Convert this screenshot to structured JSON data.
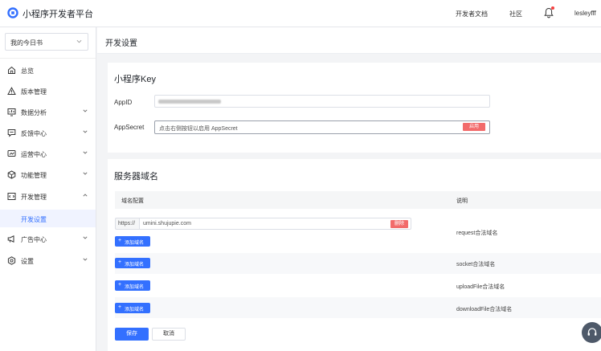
{
  "header": {
    "brand": "小程序开发者平台",
    "links": [
      "开发者文档",
      "社区"
    ],
    "user": "lesleyfff"
  },
  "sidebar": {
    "app_select": "我的今日书",
    "items": [
      {
        "label": "总览",
        "icon": "home-icon",
        "expandable": false
      },
      {
        "label": "版本管理",
        "icon": "version-icon",
        "expandable": false
      },
      {
        "label": "数据分析",
        "icon": "chart-icon",
        "expandable": true
      },
      {
        "label": "反馈中心",
        "icon": "feedback-icon",
        "expandable": true
      },
      {
        "label": "运营中心",
        "icon": "operation-icon",
        "expandable": true
      },
      {
        "label": "功能管理",
        "icon": "cube-icon",
        "expandable": true
      },
      {
        "label": "开发管理",
        "icon": "code-icon",
        "expandable": true,
        "expanded": true
      },
      {
        "label": "广告中心",
        "icon": "megaphone-icon",
        "expandable": true
      },
      {
        "label": "设置",
        "icon": "gear-icon",
        "expandable": true
      }
    ],
    "active_sub": "开发设置"
  },
  "page": {
    "title": "开发设置"
  },
  "key_section": {
    "title": "小程序Key",
    "appid_label": "AppID",
    "appsecret_label": "AppSecret",
    "appsecret_placeholder": "点击右侧按钮以启用 AppSecret",
    "appsecret_button": "启用"
  },
  "domain_section": {
    "title": "服务器域名",
    "col_config": "域名配置",
    "col_desc": "说明",
    "prefix": "https://",
    "request_url": "umini.shujupie.com",
    "delete_button": "删除",
    "add_button": "添加域名",
    "rows": [
      {
        "desc": "request合法域名"
      },
      {
        "desc": "socket合法域名"
      },
      {
        "desc": "uploadFile合法域名"
      },
      {
        "desc": "downloadFile合法域名"
      }
    ]
  },
  "actions": {
    "save": "保存",
    "cancel": "取消"
  },
  "colors": {
    "primary": "#3370ff",
    "danger": "#f26b6b",
    "notification": "#f53f3f"
  }
}
